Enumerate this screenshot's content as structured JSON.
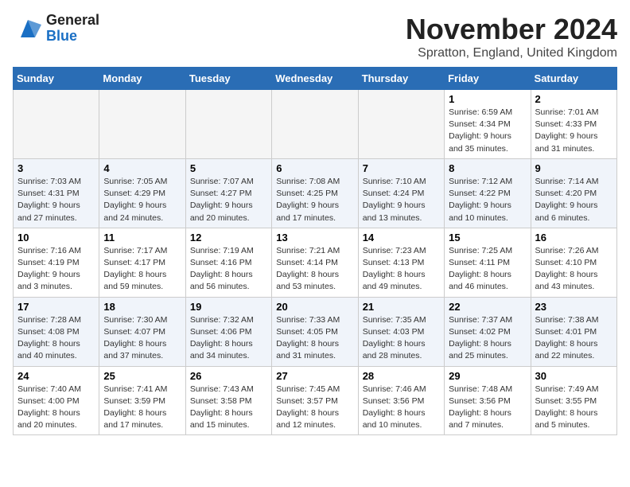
{
  "header": {
    "logo_general": "General",
    "logo_blue": "Blue",
    "month_title": "November 2024",
    "subtitle": "Spratton, England, United Kingdom"
  },
  "days_of_week": [
    "Sunday",
    "Monday",
    "Tuesday",
    "Wednesday",
    "Thursday",
    "Friday",
    "Saturday"
  ],
  "weeks": [
    [
      {
        "day": "",
        "detail": "",
        "empty": true
      },
      {
        "day": "",
        "detail": "",
        "empty": true
      },
      {
        "day": "",
        "detail": "",
        "empty": true
      },
      {
        "day": "",
        "detail": "",
        "empty": true
      },
      {
        "day": "",
        "detail": "",
        "empty": true
      },
      {
        "day": "1",
        "detail": "Sunrise: 6:59 AM\nSunset: 4:34 PM\nDaylight: 9 hours and 35 minutes."
      },
      {
        "day": "2",
        "detail": "Sunrise: 7:01 AM\nSunset: 4:33 PM\nDaylight: 9 hours and 31 minutes."
      }
    ],
    [
      {
        "day": "3",
        "detail": "Sunrise: 7:03 AM\nSunset: 4:31 PM\nDaylight: 9 hours and 27 minutes."
      },
      {
        "day": "4",
        "detail": "Sunrise: 7:05 AM\nSunset: 4:29 PM\nDaylight: 9 hours and 24 minutes."
      },
      {
        "day": "5",
        "detail": "Sunrise: 7:07 AM\nSunset: 4:27 PM\nDaylight: 9 hours and 20 minutes."
      },
      {
        "day": "6",
        "detail": "Sunrise: 7:08 AM\nSunset: 4:25 PM\nDaylight: 9 hours and 17 minutes."
      },
      {
        "day": "7",
        "detail": "Sunrise: 7:10 AM\nSunset: 4:24 PM\nDaylight: 9 hours and 13 minutes."
      },
      {
        "day": "8",
        "detail": "Sunrise: 7:12 AM\nSunset: 4:22 PM\nDaylight: 9 hours and 10 minutes."
      },
      {
        "day": "9",
        "detail": "Sunrise: 7:14 AM\nSunset: 4:20 PM\nDaylight: 9 hours and 6 minutes."
      }
    ],
    [
      {
        "day": "10",
        "detail": "Sunrise: 7:16 AM\nSunset: 4:19 PM\nDaylight: 9 hours and 3 minutes."
      },
      {
        "day": "11",
        "detail": "Sunrise: 7:17 AM\nSunset: 4:17 PM\nDaylight: 8 hours and 59 minutes."
      },
      {
        "day": "12",
        "detail": "Sunrise: 7:19 AM\nSunset: 4:16 PM\nDaylight: 8 hours and 56 minutes."
      },
      {
        "day": "13",
        "detail": "Sunrise: 7:21 AM\nSunset: 4:14 PM\nDaylight: 8 hours and 53 minutes."
      },
      {
        "day": "14",
        "detail": "Sunrise: 7:23 AM\nSunset: 4:13 PM\nDaylight: 8 hours and 49 minutes."
      },
      {
        "day": "15",
        "detail": "Sunrise: 7:25 AM\nSunset: 4:11 PM\nDaylight: 8 hours and 46 minutes."
      },
      {
        "day": "16",
        "detail": "Sunrise: 7:26 AM\nSunset: 4:10 PM\nDaylight: 8 hours and 43 minutes."
      }
    ],
    [
      {
        "day": "17",
        "detail": "Sunrise: 7:28 AM\nSunset: 4:08 PM\nDaylight: 8 hours and 40 minutes."
      },
      {
        "day": "18",
        "detail": "Sunrise: 7:30 AM\nSunset: 4:07 PM\nDaylight: 8 hours and 37 minutes."
      },
      {
        "day": "19",
        "detail": "Sunrise: 7:32 AM\nSunset: 4:06 PM\nDaylight: 8 hours and 34 minutes."
      },
      {
        "day": "20",
        "detail": "Sunrise: 7:33 AM\nSunset: 4:05 PM\nDaylight: 8 hours and 31 minutes."
      },
      {
        "day": "21",
        "detail": "Sunrise: 7:35 AM\nSunset: 4:03 PM\nDaylight: 8 hours and 28 minutes."
      },
      {
        "day": "22",
        "detail": "Sunrise: 7:37 AM\nSunset: 4:02 PM\nDaylight: 8 hours and 25 minutes."
      },
      {
        "day": "23",
        "detail": "Sunrise: 7:38 AM\nSunset: 4:01 PM\nDaylight: 8 hours and 22 minutes."
      }
    ],
    [
      {
        "day": "24",
        "detail": "Sunrise: 7:40 AM\nSunset: 4:00 PM\nDaylight: 8 hours and 20 minutes."
      },
      {
        "day": "25",
        "detail": "Sunrise: 7:41 AM\nSunset: 3:59 PM\nDaylight: 8 hours and 17 minutes."
      },
      {
        "day": "26",
        "detail": "Sunrise: 7:43 AM\nSunset: 3:58 PM\nDaylight: 8 hours and 15 minutes."
      },
      {
        "day": "27",
        "detail": "Sunrise: 7:45 AM\nSunset: 3:57 PM\nDaylight: 8 hours and 12 minutes."
      },
      {
        "day": "28",
        "detail": "Sunrise: 7:46 AM\nSunset: 3:56 PM\nDaylight: 8 hours and 10 minutes."
      },
      {
        "day": "29",
        "detail": "Sunrise: 7:48 AM\nSunset: 3:56 PM\nDaylight: 8 hours and 7 minutes."
      },
      {
        "day": "30",
        "detail": "Sunrise: 7:49 AM\nSunset: 3:55 PM\nDaylight: 8 hours and 5 minutes."
      }
    ]
  ]
}
